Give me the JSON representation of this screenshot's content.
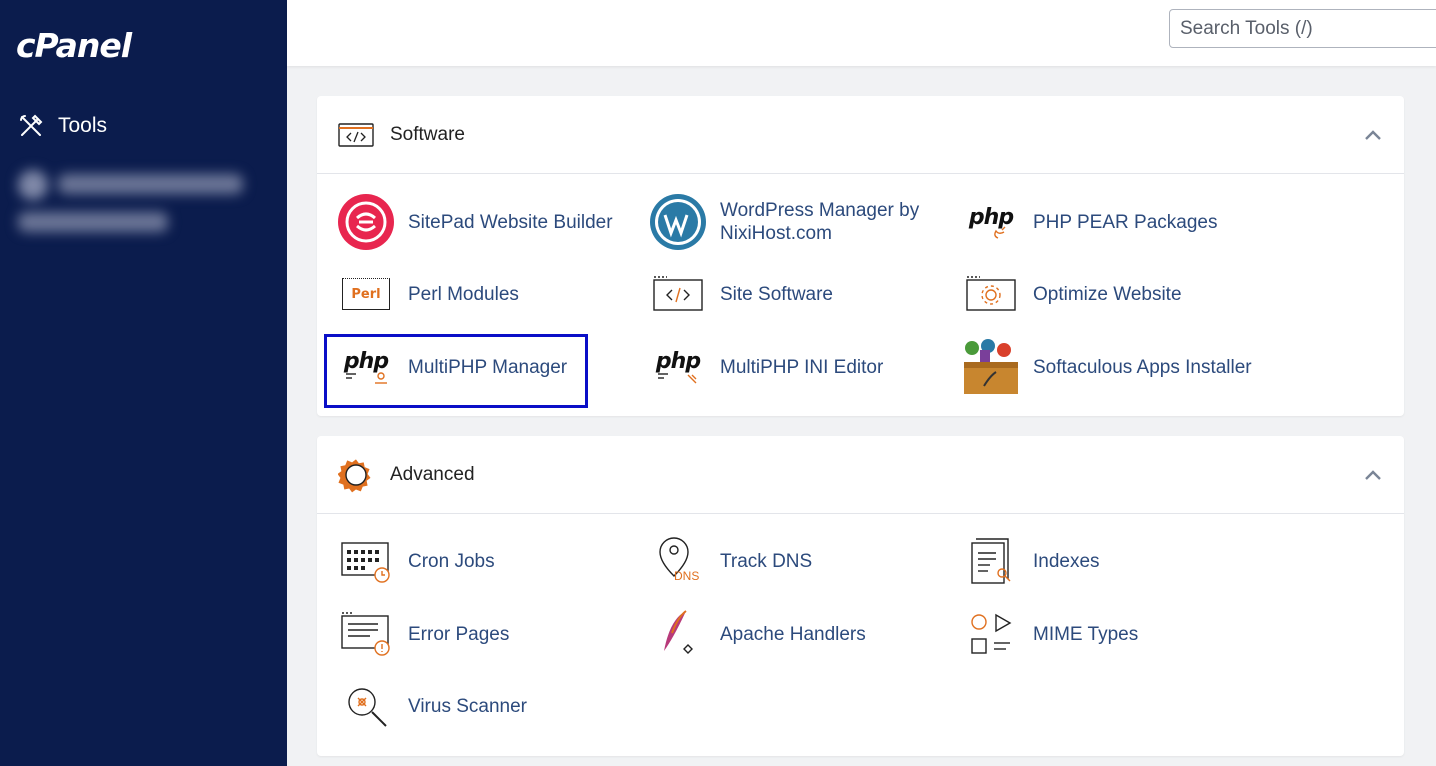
{
  "brand": {
    "logo_text": "cPanel"
  },
  "sidebar": {
    "items": [
      {
        "label": "Tools",
        "icon": "tools-icon"
      }
    ]
  },
  "search": {
    "placeholder": "Search Tools (/)"
  },
  "sections": {
    "software": {
      "title": "Software",
      "icon": "code-window-icon",
      "items": [
        {
          "label": "SitePad Website Builder",
          "icon": "sitepad-icon"
        },
        {
          "label": "WordPress Manager by NixiHost.com",
          "icon": "wordpress-icon"
        },
        {
          "label": "PHP PEAR Packages",
          "icon": "php-pear-icon",
          "icon_text": "php"
        },
        {
          "label": "Perl Modules",
          "icon": "perl-icon",
          "icon_text": "Perl"
        },
        {
          "label": "Site Software",
          "icon": "site-software-icon"
        },
        {
          "label": "Optimize Website",
          "icon": "optimize-website-icon"
        },
        {
          "label": "MultiPHP Manager",
          "icon": "multiphp-manager-icon",
          "icon_text": "php"
        },
        {
          "label": "MultiPHP INI Editor",
          "icon": "multiphp-ini-icon",
          "icon_text": "php"
        },
        {
          "label": "Softaculous Apps Installer",
          "icon": "softaculous-icon"
        }
      ]
    },
    "advanced": {
      "title": "Advanced",
      "icon": "gear-icon",
      "items": [
        {
          "label": "Cron Jobs",
          "icon": "calendar-clock-icon"
        },
        {
          "label": "Track DNS",
          "icon": "location-pin-icon",
          "icon_text": "DNS"
        },
        {
          "label": "Indexes",
          "icon": "document-search-icon"
        },
        {
          "label": "Error Pages",
          "icon": "error-page-icon"
        },
        {
          "label": "Apache Handlers",
          "icon": "apache-feather-icon"
        },
        {
          "label": "MIME Types",
          "icon": "shapes-icon"
        },
        {
          "label": "Virus Scanner",
          "icon": "virus-scan-icon"
        }
      ]
    }
  },
  "colors": {
    "sidebar_bg": "#0b1c4d",
    "link": "#2c4a7c",
    "accent_orange": "#e0701f",
    "highlight_border": "#0a0fc7"
  }
}
